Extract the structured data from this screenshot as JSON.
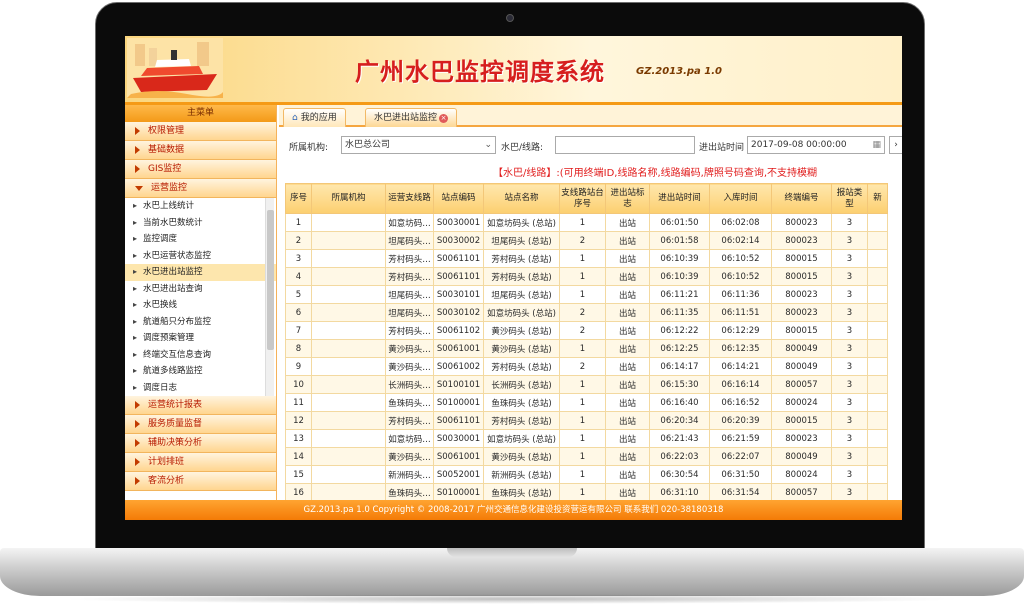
{
  "app": {
    "title": "广州水巴监控调度系统",
    "version": "GZ.2013.pa 1.0"
  },
  "sidebar": {
    "main_menu": "主菜单",
    "groups_top": [
      {
        "label": "权限管理"
      },
      {
        "label": "基础数据"
      },
      {
        "label": "GIS监控"
      },
      {
        "label": "运营监控"
      }
    ],
    "sub_items": [
      {
        "label": "水巴上线统计"
      },
      {
        "label": "当前水巴数统计"
      },
      {
        "label": "监控调度"
      },
      {
        "label": "水巴运营状态监控"
      },
      {
        "label": "水巴进出站监控"
      },
      {
        "label": "水巴进出站查询"
      },
      {
        "label": "水巴换线"
      },
      {
        "label": "航道船只分布监控"
      },
      {
        "label": "调度预案管理"
      },
      {
        "label": "终端交互信息查询"
      },
      {
        "label": "航道多线路监控"
      },
      {
        "label": "调度日志"
      }
    ],
    "groups_bottom": [
      {
        "label": "运营统计报表"
      },
      {
        "label": "服务质量监督"
      },
      {
        "label": "辅助决策分析"
      },
      {
        "label": "计划排班"
      },
      {
        "label": "客流分析"
      }
    ]
  },
  "tabs": [
    {
      "label": "我的应用"
    },
    {
      "label": "水巴进出站监控"
    }
  ],
  "filter": {
    "org_label": "所属机构:",
    "org_value": "水巴总公司",
    "line_label": "水巴/线路:",
    "line_value": "",
    "time_label": "进出站时间",
    "time_value": "2017-09-08 00:00:00"
  },
  "hint": "【水巴/线路】:(可用终端ID,线路名称,线路编码,牌照号码查询,不支持模糊",
  "table": {
    "columns": [
      "序号",
      "所属机构",
      "运营支线路",
      "站点编码",
      "站点名称",
      "支线路站台序号",
      "进出站标志",
      "进出站时间",
      "入库时间",
      "终端编号",
      "报站类型",
      "新"
    ],
    "rows": [
      [
        "1",
        "",
        "如意坊码…",
        "S0030001",
        "如意坊码头 (总站)",
        "1",
        "出站",
        "06:01:50",
        "06:02:08",
        "800023",
        "3",
        ""
      ],
      [
        "2",
        "",
        "坦尾码头…",
        "S0030002",
        "坦尾码头 (总站)",
        "2",
        "出站",
        "06:01:58",
        "06:02:14",
        "800023",
        "3",
        ""
      ],
      [
        "3",
        "",
        "芳村码头…",
        "S0061101",
        "芳村码头 (总站)",
        "1",
        "出站",
        "06:10:39",
        "06:10:52",
        "800015",
        "3",
        ""
      ],
      [
        "4",
        "",
        "芳村码头…",
        "S0061101",
        "芳村码头 (总站)",
        "1",
        "出站",
        "06:10:39",
        "06:10:52",
        "800015",
        "3",
        ""
      ],
      [
        "5",
        "",
        "坦尾码头…",
        "S0030101",
        "坦尾码头 (总站)",
        "1",
        "出站",
        "06:11:21",
        "06:11:36",
        "800023",
        "3",
        ""
      ],
      [
        "6",
        "",
        "坦尾码头…",
        "S0030102",
        "如意坊码头 (总站)",
        "2",
        "出站",
        "06:11:35",
        "06:11:51",
        "800023",
        "3",
        ""
      ],
      [
        "7",
        "",
        "芳村码头…",
        "S0061102",
        "黄沙码头 (总站)",
        "2",
        "出站",
        "06:12:22",
        "06:12:29",
        "800015",
        "3",
        ""
      ],
      [
        "8",
        "",
        "黄沙码头…",
        "S0061001",
        "黄沙码头 (总站)",
        "1",
        "出站",
        "06:12:25",
        "06:12:35",
        "800049",
        "3",
        ""
      ],
      [
        "9",
        "",
        "黄沙码头…",
        "S0061002",
        "芳村码头 (总站)",
        "2",
        "出站",
        "06:14:17",
        "06:14:21",
        "800049",
        "3",
        ""
      ],
      [
        "10",
        "",
        "长洲码头…",
        "S0100101",
        "长洲码头 (总站)",
        "1",
        "出站",
        "06:15:30",
        "06:16:14",
        "800057",
        "3",
        ""
      ],
      [
        "11",
        "",
        "鱼珠码头…",
        "S0100001",
        "鱼珠码头 (总站)",
        "1",
        "出站",
        "06:16:40",
        "06:16:52",
        "800024",
        "3",
        ""
      ],
      [
        "12",
        "",
        "芳村码头…",
        "S0061101",
        "芳村码头 (总站)",
        "1",
        "出站",
        "06:20:34",
        "06:20:39",
        "800015",
        "3",
        ""
      ],
      [
        "13",
        "",
        "如意坊码…",
        "S0030001",
        "如意坊码头 (总站)",
        "1",
        "出站",
        "06:21:43",
        "06:21:59",
        "800023",
        "3",
        ""
      ],
      [
        "14",
        "",
        "黄沙码头…",
        "S0061001",
        "黄沙码头 (总站)",
        "1",
        "出站",
        "06:22:03",
        "06:22:07",
        "800049",
        "3",
        ""
      ],
      [
        "15",
        "",
        "新洲码头…",
        "S0052001",
        "新洲码头 (总站)",
        "1",
        "出站",
        "06:30:54",
        "06:31:50",
        "800024",
        "3",
        ""
      ],
      [
        "16",
        "",
        "鱼珠码头…",
        "S0100001",
        "鱼珠码头 (总站)",
        "1",
        "出站",
        "06:31:10",
        "06:31:54",
        "800057",
        "3",
        ""
      ]
    ]
  },
  "footer": "GZ.2013.pa 1.0 Copyright © 2008-2017 广州交通信息化建设投资营运有限公司 联系我们 020-38180318",
  "colors": {
    "brand_orange": "#f47b06",
    "title_red": "#d61e1e",
    "hint_red": "#e11b1b"
  }
}
